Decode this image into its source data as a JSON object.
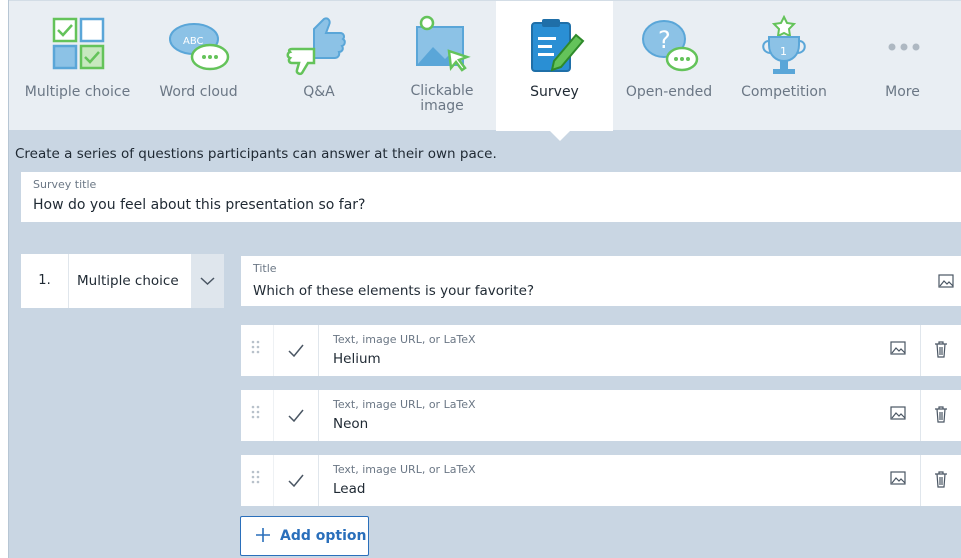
{
  "question_types": [
    {
      "label": "Multiple choice",
      "icon": "multiple-choice-icon"
    },
    {
      "label": "Word cloud",
      "icon": "word-cloud-icon"
    },
    {
      "label": "Q&A",
      "icon": "qa-icon"
    },
    {
      "label": "Clickable\nimage",
      "icon": "clickable-image-icon"
    },
    {
      "label": "Survey",
      "icon": "survey-icon",
      "active": true
    },
    {
      "label": "Open-ended",
      "icon": "open-ended-icon"
    },
    {
      "label": "Competition",
      "icon": "competition-icon"
    },
    {
      "label": "More",
      "icon": "more-icon"
    }
  ],
  "description": "Create a series of questions participants can answer at their own pace.",
  "survey": {
    "title_label": "Survey title",
    "title_value": "How do you feel about this presentation so far?"
  },
  "question": {
    "number": "1.",
    "type": "Multiple choice",
    "title_label": "Title",
    "title_value": "Which of these elements is your favorite?"
  },
  "options": [
    {
      "placeholder": "Text, image URL, or LaTeX",
      "value": "Helium"
    },
    {
      "placeholder": "Text, image URL, or LaTeX",
      "value": "Neon"
    },
    {
      "placeholder": "Text, image URL, or LaTeX",
      "value": "Lead"
    }
  ],
  "add_option_label": "Add option",
  "colors": {
    "accent": "#2a6fbb",
    "icon_blue": "#5aa6d8",
    "icon_green": "#64c35a",
    "background": "#c9d6e3"
  }
}
